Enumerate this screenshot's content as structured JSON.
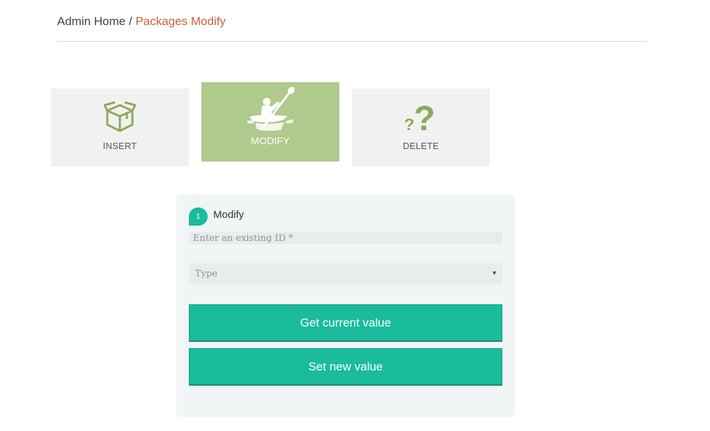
{
  "breadcrumb": {
    "home": "Admin Home",
    "separator": "/",
    "current": "Packages Modify"
  },
  "tiles": [
    {
      "label": "INSERT",
      "icon": "box-icon",
      "active": false
    },
    {
      "label": "MODIFY",
      "icon": "kayaker-icon",
      "active": true
    },
    {
      "label": "DELETE",
      "icon": "question-marks-icon",
      "active": false
    }
  ],
  "form": {
    "step_number": "1",
    "step_title": "Modify",
    "id_placeholder": "Enter an existing ID *",
    "type_select": "Type",
    "get_button": "Get current value",
    "set_button": "Set new value"
  },
  "colors": {
    "accent": "#1abc9c",
    "active_tile": "#b0c98c",
    "icon_green": "#8fa85a",
    "breadcrumb_current": "#d1603d"
  }
}
